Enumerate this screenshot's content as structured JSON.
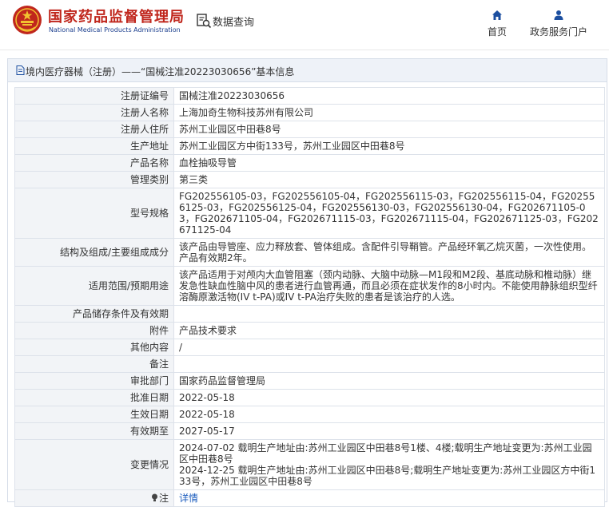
{
  "header": {
    "brand_cn": "国家药品监督管理局",
    "brand_en": "National Medical Products Administration",
    "query_label": "数据查询",
    "nav": {
      "home": "首页",
      "gov": "政务服务门户"
    }
  },
  "panel": {
    "title": "境内医疗器械（注册）——“国械注准20223030656”基本信息"
  },
  "rows": [
    {
      "label": "注册证编号",
      "value": "国械注准20223030656"
    },
    {
      "label": "注册人名称",
      "value": "上海加奇生物科技苏州有限公司"
    },
    {
      "label": "注册人住所",
      "value": "苏州工业园区中田巷8号"
    },
    {
      "label": "生产地址",
      "value": "苏州工业园区方中街133号，苏州工业园区中田巷8号"
    },
    {
      "label": "产品名称",
      "value": "血栓抽吸导管"
    },
    {
      "label": "管理类别",
      "value": "第三类"
    },
    {
      "label": "型号规格",
      "value": "FG202556105-03，FG202556105-04，FG202556115-03，FG202556115-04，FG202556125-03，FG202556125-04，FG202556130-03，FG202556130-04，FG202671105-03，FG202671105-04，FG202671115-03，FG202671115-04，FG202671125-03，FG202671125-04"
    },
    {
      "label": "结构及组成/主要组成成分",
      "value": "该产品由导管座、应力释放套、管体组成。含配件引导鞘管。产品经环氧乙烷灭菌，一次性使用。产品有效期2年。"
    },
    {
      "label": "适用范围/预期用途",
      "value": "该产品适用于对颅内大血管阻塞（颈内动脉、大脑中动脉—M1段和M2段、基底动脉和椎动脉）继发急性缺血性脑中风的患者进行血管再通，而且必须在症状发作的8小时内。不能使用静脉组织型纤溶酶原激活物(IV t-PA)或IV t-PA治疗失败的患者是该治疗的人选。"
    },
    {
      "label": "产品储存条件及有效期",
      "value": ""
    },
    {
      "label": "附件",
      "value": "产品技术要求"
    },
    {
      "label": "其他内容",
      "value": "/"
    },
    {
      "label": "备注",
      "value": ""
    },
    {
      "label": "审批部门",
      "value": "国家药品监督管理局"
    },
    {
      "label": "批准日期",
      "value": "2022-05-18"
    },
    {
      "label": "生效日期",
      "value": "2022-05-18"
    },
    {
      "label": "有效期至",
      "value": "2027-05-17"
    },
    {
      "label": "变更情况",
      "value_lines": [
        "2024-07-02 载明生产地址由:苏州工业园区中田巷8号1楼、4楼;载明生产地址变更为:苏州工业园区中田巷8号",
        "2024-12-25 载明生产地址由:苏州工业园区中田巷8号;载明生产地址变更为:苏州工业园区方中街133号，苏州工业园区中田巷8号"
      ]
    },
    {
      "label": "注",
      "value": "详情",
      "icon": "lightbulb-icon"
    }
  ],
  "colors": {
    "brand_red": "#c0271d",
    "brand_blue": "#1c3f8e",
    "link_blue": "#1f5fbf",
    "label_bg": "#f2f4f7"
  }
}
